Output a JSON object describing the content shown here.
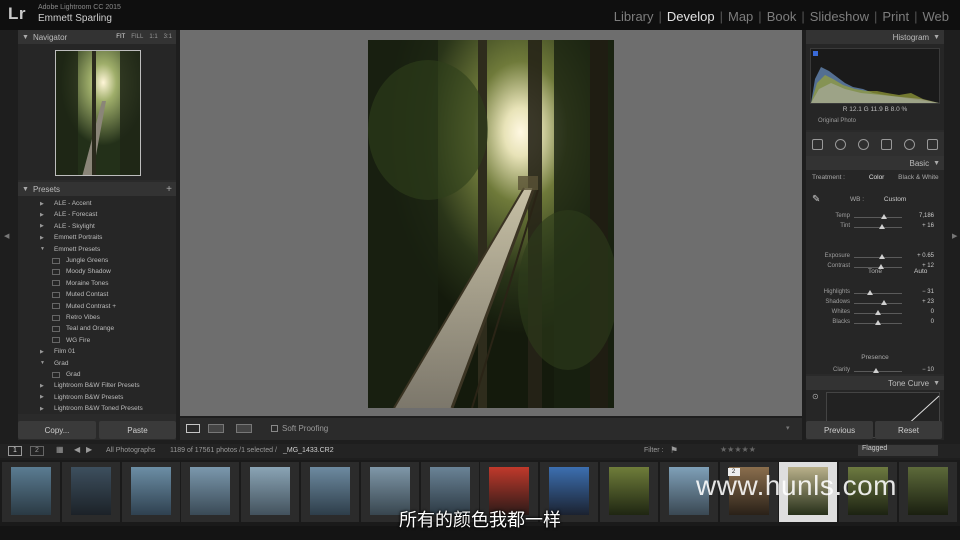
{
  "app": {
    "logo": "Lr",
    "product": "Adobe Lightroom CC 2015",
    "user": "Emmett Sparling"
  },
  "modules": [
    "Library",
    "Develop",
    "Map",
    "Book",
    "Slideshow",
    "Print",
    "Web"
  ],
  "active_module": "Develop",
  "navigator": {
    "title": "Navigator",
    "zoom_options": [
      "FIT",
      "FILL",
      "1:1",
      "3:1"
    ],
    "selected_zoom": "FIT"
  },
  "presets": {
    "title": "Presets",
    "add_icon": "plus-icon",
    "items": [
      {
        "label": "ALE - Accent",
        "level": 0,
        "state": "collapsed"
      },
      {
        "label": "ALE - Forecast",
        "level": 0,
        "state": "collapsed"
      },
      {
        "label": "ALE - Skylight",
        "level": 0,
        "state": "collapsed"
      },
      {
        "label": "Emmett Portraits",
        "level": 0,
        "state": "collapsed"
      },
      {
        "label": "Emmett Presets",
        "level": 0,
        "state": "expanded"
      },
      {
        "label": "Jungle Greens",
        "level": 1
      },
      {
        "label": "Moody Shadow",
        "level": 1
      },
      {
        "label": "Moraine Tones",
        "level": 1
      },
      {
        "label": "Muted Contast",
        "level": 1
      },
      {
        "label": "Muted Contrast +",
        "level": 1
      },
      {
        "label": "Retro Vibes",
        "level": 1
      },
      {
        "label": "Teal and Orange",
        "level": 1
      },
      {
        "label": "WG Fire",
        "level": 1
      },
      {
        "label": "Film 01",
        "level": 0,
        "state": "collapsed"
      },
      {
        "label": "Grad",
        "level": 0,
        "state": "expanded"
      },
      {
        "label": "Grad",
        "level": 1
      },
      {
        "label": "Lightroom B&W Filter Presets",
        "level": 0,
        "state": "collapsed"
      },
      {
        "label": "Lightroom B&W Presets",
        "level": 0,
        "state": "collapsed"
      },
      {
        "label": "Lightroom B&W Toned Presets",
        "level": 0,
        "state": "collapsed"
      }
    ]
  },
  "buttons": {
    "copy": "Copy...",
    "paste": "Paste",
    "previous": "Previous",
    "reset": "Reset"
  },
  "toolbar": {
    "soft_proofing": "Soft Proofing"
  },
  "histogram": {
    "title": "Histogram",
    "rgb_readout": "R 12.1 G 11.9 B 8.0 %",
    "original_photo": "Original Photo"
  },
  "basic": {
    "title": "Basic",
    "treatment_label": "Treatment :",
    "treatment_color": "Color",
    "treatment_bw": "Black & White",
    "wb_label": "WB :",
    "wb_value": "Custom",
    "tone_label": "Tone",
    "auto_label": "Auto",
    "presence_label": "Presence",
    "sliders": [
      {
        "label": "Temp",
        "value": "7,186",
        "pos": 0.62
      },
      {
        "label": "Tint",
        "value": "+ 16",
        "pos": 0.58
      },
      {
        "label": "Exposure",
        "value": "+ 0.65",
        "pos": 0.58
      },
      {
        "label": "Contrast",
        "value": "+ 12",
        "pos": 0.56
      },
      {
        "label": "Highlights",
        "value": "− 31",
        "pos": 0.34
      },
      {
        "label": "Shadows",
        "value": "+ 23",
        "pos": 0.62
      },
      {
        "label": "Whites",
        "value": "0",
        "pos": 0.5
      },
      {
        "label": "Blacks",
        "value": "0",
        "pos": 0.5
      },
      {
        "label": "Clarity",
        "value": "− 10",
        "pos": 0.45
      },
      {
        "label": "Vibrance",
        "value": "+ 10",
        "pos": 0.55
      },
      {
        "label": "Saturation",
        "value": "0",
        "pos": 0.5
      }
    ]
  },
  "tone_curve": {
    "title": "Tone Curve"
  },
  "filmstrip": {
    "page_buttons": [
      "1",
      "2"
    ],
    "source": "All Photographs",
    "count_text": "1189 of 17561 photos /1 selected /",
    "filename": "_MG_1433.CR2",
    "filter_label": "Filter :",
    "filter_value": "Flagged",
    "badge": "2"
  },
  "watermark": "www.hunls.com",
  "subtitle": "所有的颜色我都一样"
}
